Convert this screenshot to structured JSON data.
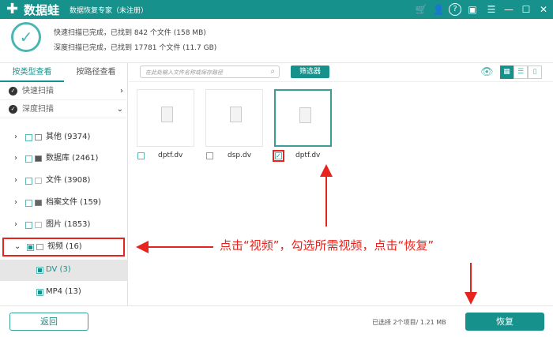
{
  "titlebar": {
    "logo": "数据蛙",
    "title": "数据恢复专家（未注册）",
    "icons": [
      "cart-icon",
      "user-icon",
      "help-icon",
      "save-icon",
      "menu-icon",
      "minimize-icon",
      "maximize-icon",
      "close-icon"
    ]
  },
  "header": {
    "quick_scan": "快速扫描已完成，已找到 842 个文件 (158 MB)",
    "deep_scan": "深度扫描已完成，已找到 17781 个文件 (11.7 GB)"
  },
  "sidebar": {
    "tabs": [
      "按类型查看",
      "按路径查看"
    ],
    "quick": "快速扫描",
    "deep": "深度扫描",
    "tree": [
      {
        "label": "其他 (9374)"
      },
      {
        "label": "数据库 (2461)"
      },
      {
        "label": "文件 (3908)"
      },
      {
        "label": "档案文件 (159)"
      },
      {
        "label": "图片 (1853)"
      },
      {
        "label": "视频 (16)"
      }
    ],
    "sub": [
      {
        "label": "DV (3)"
      },
      {
        "label": "MP4 (13)"
      }
    ]
  },
  "toolbar": {
    "search_placeholder": "在此处输入文件名称或保存路径",
    "filter": "筛选器"
  },
  "files": [
    {
      "name": "dptf.dv",
      "checked": false
    },
    {
      "name": "dsp.dv",
      "checked": false
    },
    {
      "name": "dptf.dv",
      "checked": true
    }
  ],
  "footer": {
    "back": "返回",
    "selected": "已选择 2个项目/ 1.21 MB",
    "restore": "恢复"
  },
  "annotation": "点击“视频”，勾选所需视频，点击“恢复”",
  "colors": {
    "accent": "#17918b",
    "annotation": "#e8231d"
  }
}
